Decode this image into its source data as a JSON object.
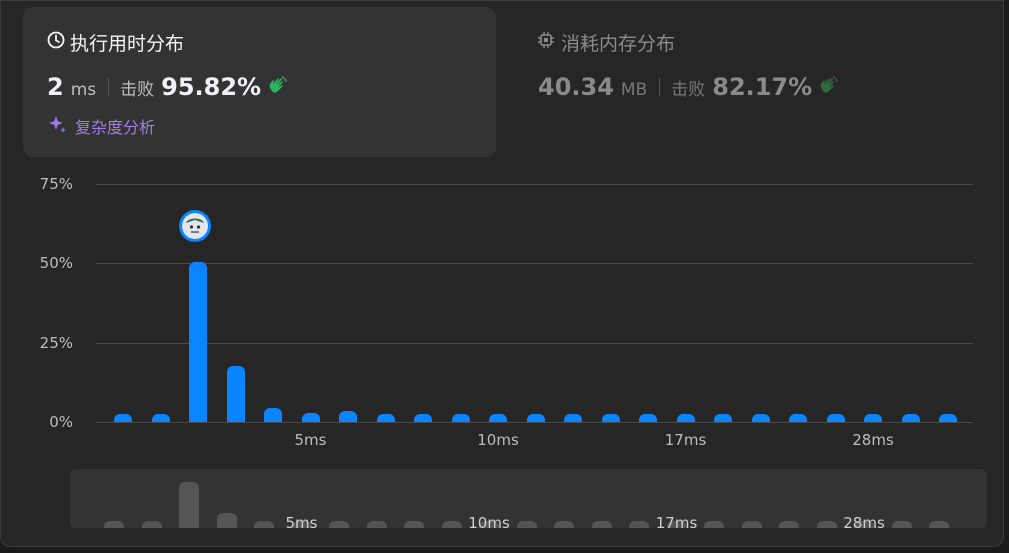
{
  "runtime": {
    "title": "执行用时分布",
    "value": "2",
    "unit": "ms",
    "beat_label": "击败",
    "beat_value": "95.82%",
    "complexity_label": "复杂度分析"
  },
  "memory": {
    "title": "消耗内存分布",
    "value": "40.34",
    "unit": "MB",
    "beat_label": "击败",
    "beat_value": "82.17%"
  },
  "colors": {
    "bar": "#0a84ff",
    "accent": "#9e7ee6",
    "wave": "#2db55d"
  },
  "chart_data": {
    "type": "bar",
    "ylabel_ticks": [
      "75%",
      "50%",
      "25%",
      "0%"
    ],
    "ylim": [
      0,
      75
    ],
    "x_tick_labels": [
      {
        "label": "5ms",
        "index": 5
      },
      {
        "label": "10ms",
        "index": 10
      },
      {
        "label": "17ms",
        "index": 15
      },
      {
        "label": "28ms",
        "index": 20
      }
    ],
    "values": [
      2.5,
      2.5,
      50.5,
      17.5,
      4.5,
      2.8,
      3.5,
      2.4,
      2.4,
      2.4,
      2.4,
      2.4,
      2.4,
      2.4,
      2.4,
      2.4,
      2.4,
      2.4,
      2.4,
      2.4,
      2.4,
      2.4,
      2.4
    ],
    "highlight_index": 2
  }
}
